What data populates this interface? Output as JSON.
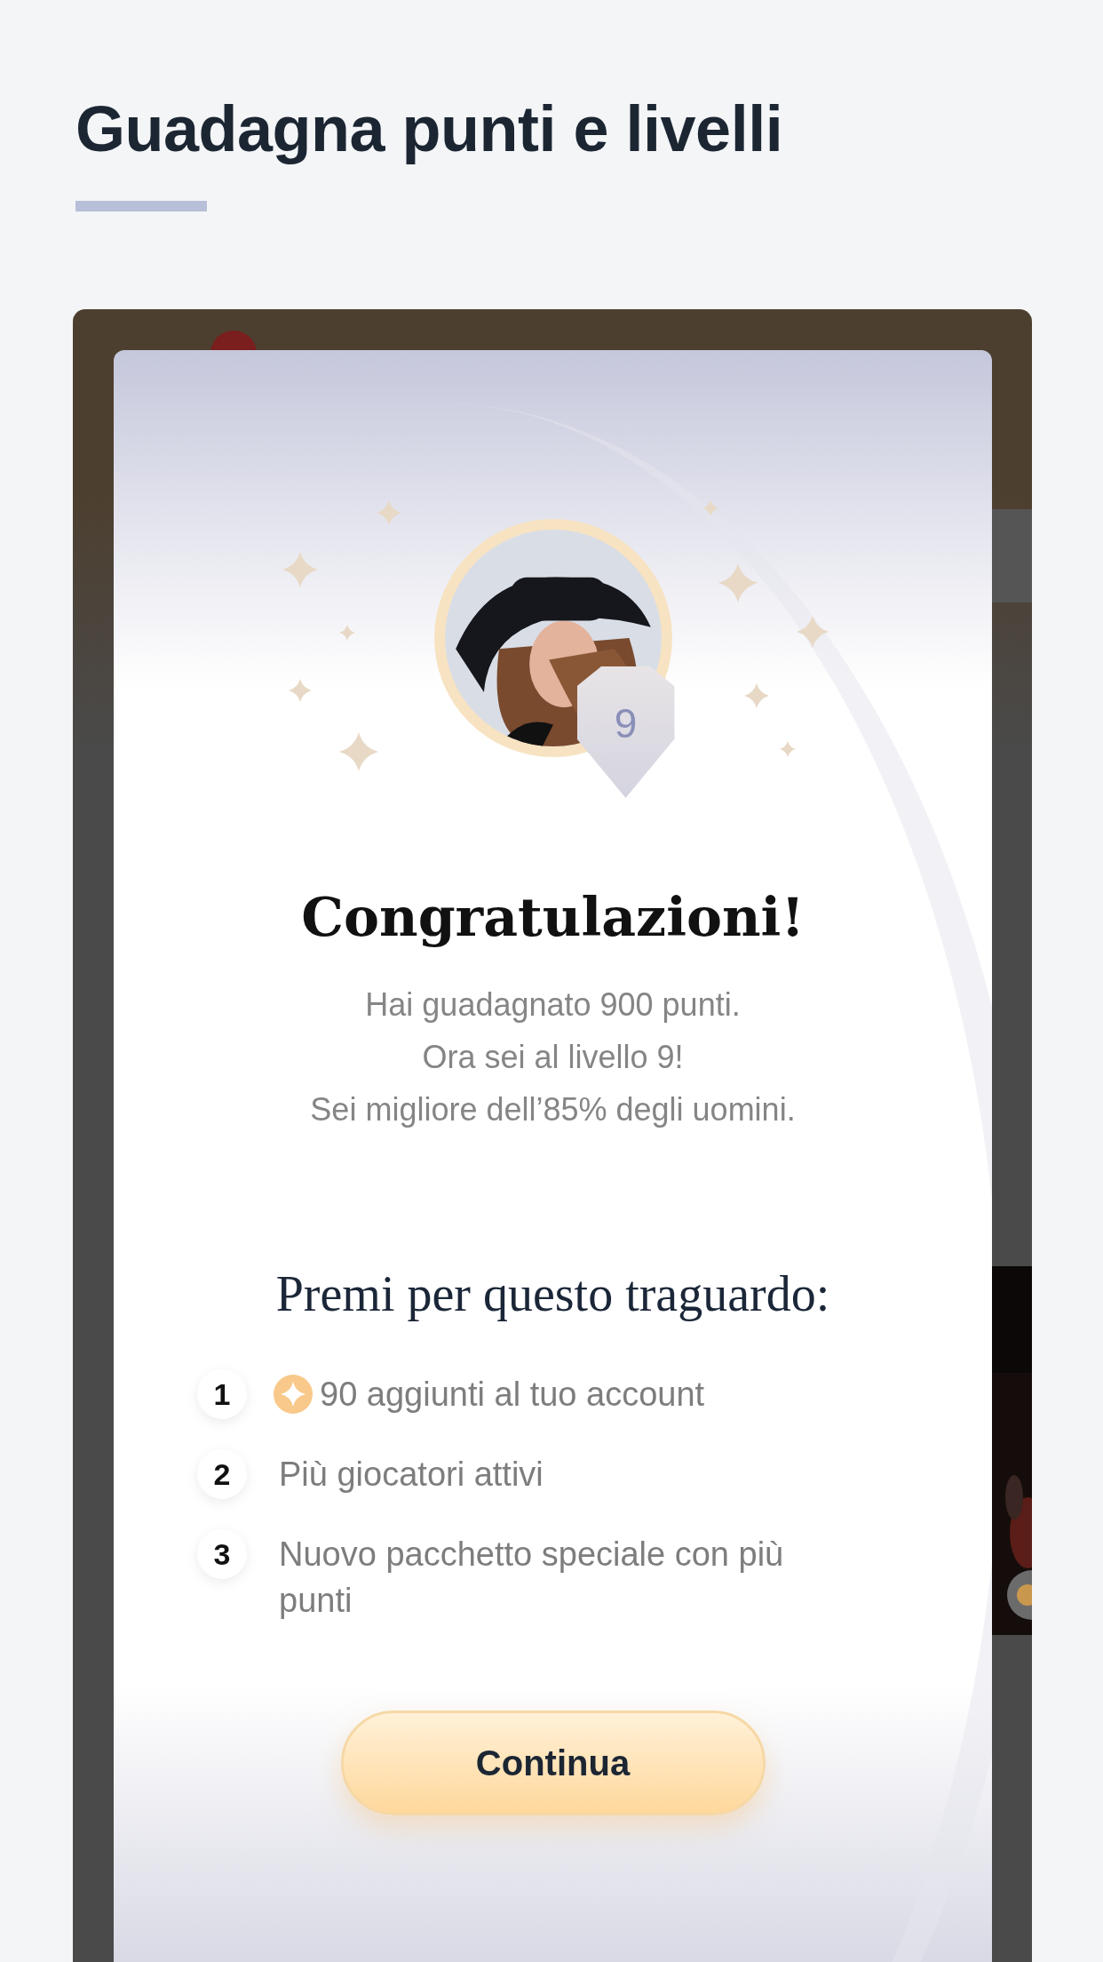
{
  "page": {
    "title": "Guadagna punti e livelli"
  },
  "dialog": {
    "level_badge": "9",
    "heading": "Congratulazioni!",
    "message_lines": [
      "Hai guadagnato 900 punti.",
      "Ora sei al livello 9!",
      "Sei migliore dell’85% degli uomini."
    ],
    "rewards_title": "Premi per questo traguardo:",
    "rewards": [
      {
        "number": "1",
        "kind": "coins",
        "text": "90 aggiunti al tuo account"
      },
      {
        "number": "2",
        "kind": "plain",
        "text": "Più giocatori attivi"
      },
      {
        "number": "3",
        "kind": "plain",
        "text": "Nuovo pacchetto speciale con più punti"
      }
    ],
    "continue_button": "Continua"
  }
}
